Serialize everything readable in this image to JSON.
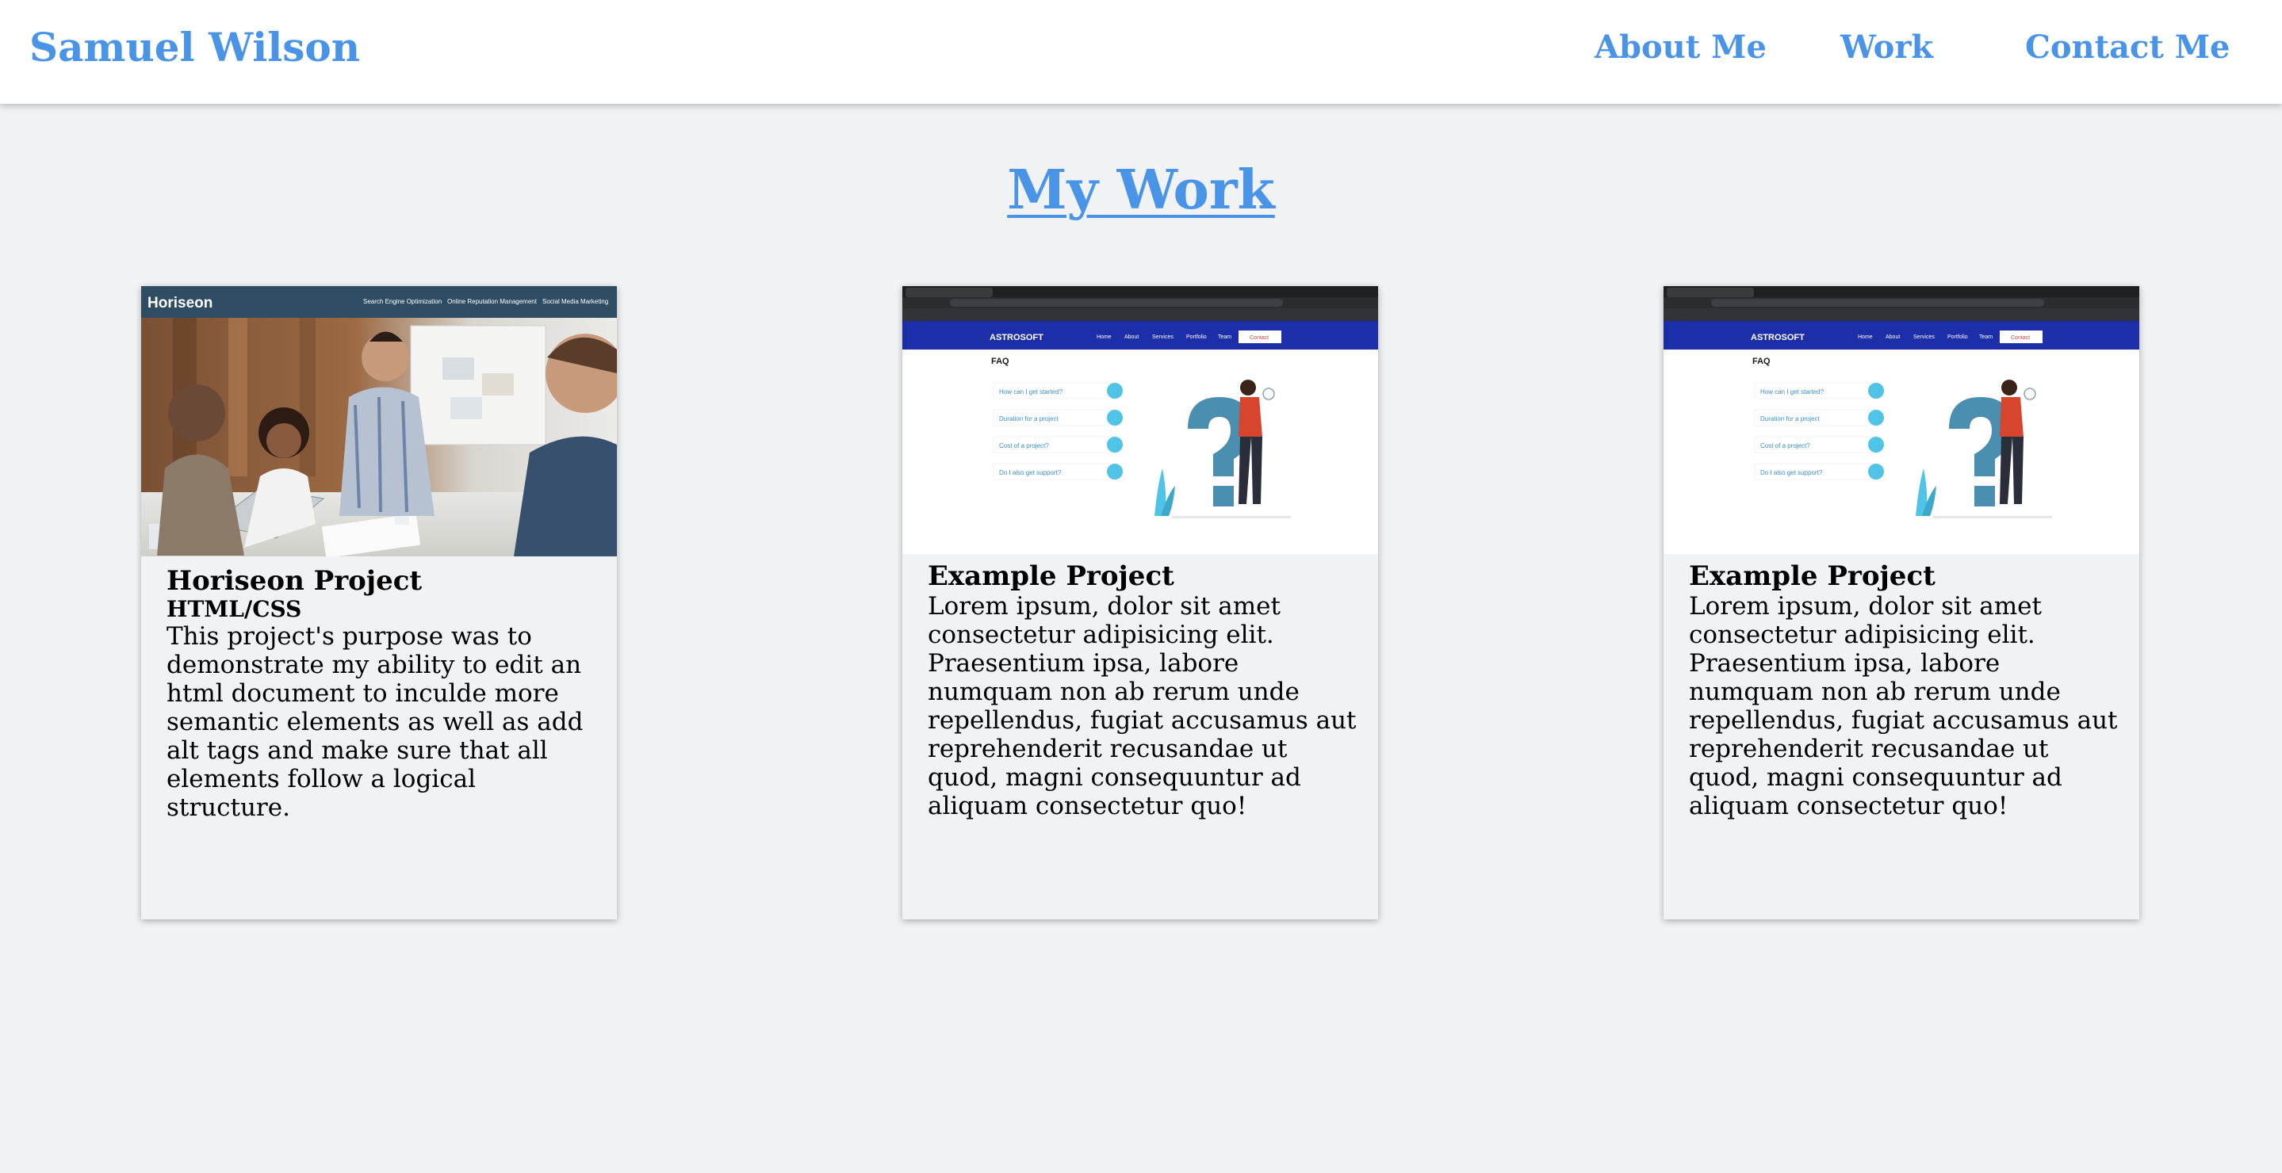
{
  "header": {
    "brand": "Samuel Wilson",
    "nav": [
      "About Me",
      "Work",
      "Contact Me"
    ]
  },
  "section": {
    "title": "My Work"
  },
  "projects": [
    {
      "title": "Horiseon Project",
      "subtitle": "HTML/CSS",
      "description": "This project's purpose was to demonstrate my ability to edit an html document to inculde more semantic elements as well as add alt tags and make sure that all elements follow a logical structure.",
      "screenshot": {
        "logo": "Horiseon",
        "nav": [
          "Search Engine Optimization",
          "Online Reputation Management",
          "Social Media Marketing"
        ]
      }
    },
    {
      "title": "Example Project",
      "description": "Lorem ipsum, dolor sit amet consectetur adipisicing elit. Praesentium ipsa, labore numquam non ab rerum unde repellendus, fugiat accusamus aut reprehenderit recusandae ut quod, magni consequuntur ad aliquam consectetur quo!",
      "screenshot": {
        "logo": "ASTROSOFT",
        "nav": [
          "Home",
          "About",
          "Services",
          "Portfolio",
          "Team"
        ],
        "cta": "Contact",
        "heading": "FAQ",
        "faqs": [
          "How can I get started?",
          "Duration for a project",
          "Cost of a project?",
          "Do I also get support?"
        ]
      }
    },
    {
      "title": "Example Project",
      "description": "Lorem ipsum, dolor sit amet consectetur adipisicing elit. Praesentium ipsa, labore numquam non ab rerum unde repellendus, fugiat accusamus aut reprehenderit recusandae ut quod, magni consequuntur ad aliquam consectetur quo!",
      "screenshot": {
        "logo": "ASTROSOFT",
        "nav": [
          "Home",
          "About",
          "Services",
          "Portfolio",
          "Team"
        ],
        "cta": "Contact",
        "heading": "FAQ",
        "faqs": [
          "How can I get started?",
          "Duration for a project",
          "Cost of a project?",
          "Do I also get support?"
        ]
      }
    }
  ],
  "colors": {
    "accent": "#4a94e8",
    "page_background": "#f1f2f4",
    "header_background": "#ffffff",
    "horiseon_header": "#2e4d62",
    "astrosoft_nav": "#1d2fa8",
    "faq_accent": "#4fc4e6"
  }
}
